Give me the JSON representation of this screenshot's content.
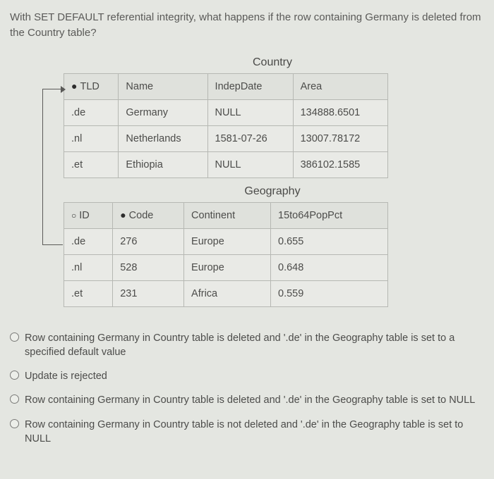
{
  "question": "With SET DEFAULT referential integrity, what happens if the row containing Germany is deleted from the Country table?",
  "tables": {
    "country": {
      "title": "Country",
      "headers": {
        "tld_prefix": "●",
        "tld": "TLD",
        "name": "Name",
        "indepdate": "IndepDate",
        "area": "Area"
      },
      "rows": [
        {
          "tld": ".de",
          "name": "Germany",
          "indepdate": "NULL",
          "area": "134888.6501"
        },
        {
          "tld": ".nl",
          "name": "Netherlands",
          "indepdate": "1581-07-26",
          "area": "13007.78172"
        },
        {
          "tld": ".et",
          "name": "Ethiopia",
          "indepdate": "NULL",
          "area": "386102.1585"
        }
      ]
    },
    "geography": {
      "title": "Geography",
      "headers": {
        "id_prefix": "○",
        "id": "ID",
        "code_prefix": "●",
        "code": "Code",
        "continent": "Continent",
        "poppct": "15to64PopPct"
      },
      "rows": [
        {
          "id": ".de",
          "code": "276",
          "continent": "Europe",
          "poppct": "0.655"
        },
        {
          "id": ".nl",
          "code": "528",
          "continent": "Europe",
          "poppct": "0.648"
        },
        {
          "id": ".et",
          "code": "231",
          "continent": "Africa",
          "poppct": "0.559"
        }
      ]
    }
  },
  "options": [
    "Row containing Germany in Country table is deleted and '.de' in the Geography table is set to a specified default value",
    "Update is rejected",
    "Row containing Germany in Country table is deleted and '.de' in the Geography table is set to NULL",
    "Row containing Germany in Country table is not deleted and '.de' in the Geography table is set to NULL"
  ]
}
